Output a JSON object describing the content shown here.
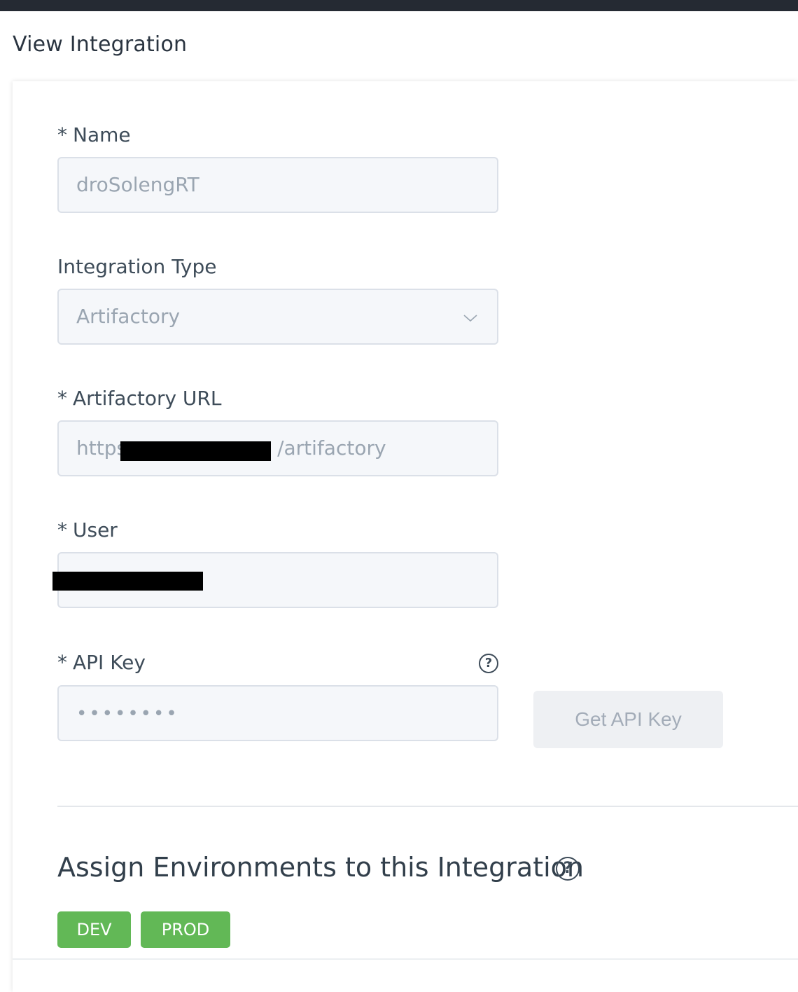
{
  "page": {
    "title": "View Integration"
  },
  "form": {
    "name": {
      "label": "Name",
      "required_mark": "*",
      "value": "droSolengRT"
    },
    "integration_type": {
      "label": "Integration Type",
      "value": "Artifactory"
    },
    "artifactory_url": {
      "label": "Artifactory URL",
      "required_mark": "*",
      "value_prefix": "https",
      "value_suffix": "/artifactory"
    },
    "user": {
      "label": "User",
      "required_mark": "*",
      "value": ""
    },
    "api_key": {
      "label": "API Key",
      "required_mark": "*",
      "value": "••••••••",
      "help": "?"
    },
    "get_api_key_label": "Get API Key"
  },
  "environments": {
    "title": "Assign Environments to this Integration",
    "help": "?",
    "tags": [
      "DEV",
      "PROD"
    ],
    "tag_color": "#62b856"
  },
  "colors": {
    "topbar": "#252a33",
    "input_bg": "#f5f7fa",
    "input_border": "#dbe0e8"
  },
  "icons": {
    "dropdown": "chevron-down-icon",
    "help": "help-circle-icon"
  }
}
